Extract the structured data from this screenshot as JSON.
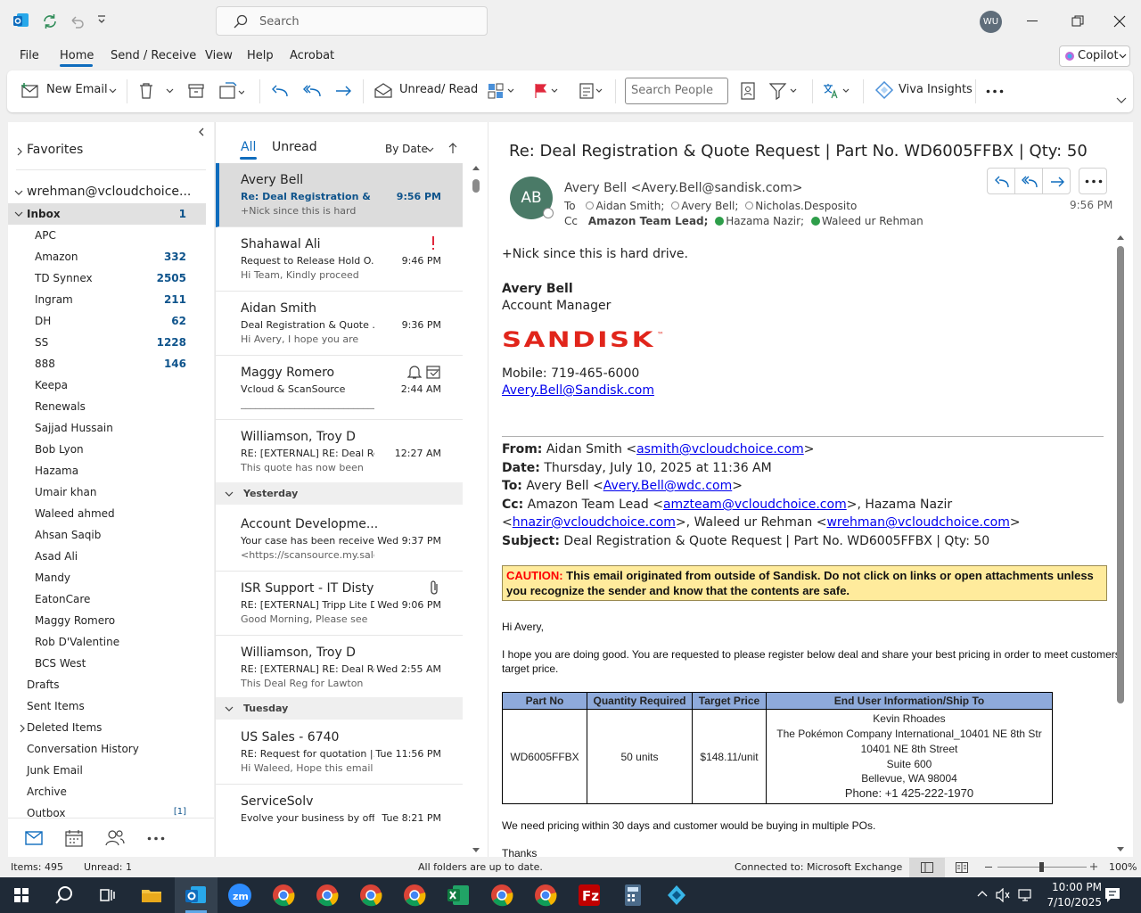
{
  "titlebar": {
    "search_placeholder": "Search",
    "user_initials": "WU"
  },
  "menu": {
    "items": [
      "File",
      "Home",
      "Send / Receive",
      "View",
      "Help",
      "Acrobat"
    ],
    "copilot": "Copilot"
  },
  "ribbon": {
    "new_email": "New Email",
    "unread_read": "Unread/ Read",
    "search_people_placeholder": "Search People",
    "viva": "Viva Insights"
  },
  "folders": {
    "favorites": "Favorites",
    "account": "wrehman@vcloudchoice...",
    "inbox": {
      "label": "Inbox",
      "count": "1"
    },
    "subfolders": [
      {
        "label": "APC",
        "count": ""
      },
      {
        "label": "Amazon",
        "count": "332"
      },
      {
        "label": "TD Synnex",
        "count": "2505"
      },
      {
        "label": "Ingram",
        "count": "211"
      },
      {
        "label": "DH",
        "count": "62"
      },
      {
        "label": "SS",
        "count": "1228"
      },
      {
        "label": "888",
        "count": "146"
      },
      {
        "label": "Keepa",
        "count": ""
      },
      {
        "label": "Renewals",
        "count": ""
      },
      {
        "label": "Sajjad Hussain",
        "count": ""
      },
      {
        "label": "Bob Lyon",
        "count": ""
      },
      {
        "label": "Hazama",
        "count": ""
      },
      {
        "label": "Umair khan",
        "count": ""
      },
      {
        "label": "Waleed ahmed",
        "count": ""
      },
      {
        "label": "Ahsan Saqib",
        "count": ""
      },
      {
        "label": "Asad Ali",
        "count": ""
      },
      {
        "label": "Mandy",
        "count": ""
      },
      {
        "label": "EatonCare",
        "count": ""
      },
      {
        "label": "Maggy Romero",
        "count": ""
      },
      {
        "label": "Rob D'Valentine",
        "count": ""
      },
      {
        "label": "BCS West",
        "count": ""
      }
    ],
    "top_level": [
      "Drafts",
      "Sent Items",
      "Deleted Items",
      "Conversation History",
      "Junk Email",
      "Archive"
    ],
    "outbox": {
      "label": "Outbox",
      "count": "[1]"
    }
  },
  "msglist": {
    "tab_all": "All",
    "tab_unread": "Unread",
    "sort": "By Date",
    "groups": {
      "yesterday": "Yesterday",
      "tuesday": "Tuesday"
    },
    "messages": [
      {
        "sender": "Avery Bell",
        "subject": "Re: Deal Registration & Qu...",
        "preview": "+Nick since this is hard",
        "time": "9:56 PM"
      },
      {
        "sender": "Shahawal Ali",
        "subject": "Request to Release Hold O...",
        "preview": "Hi Team,  Kindly proceed",
        "time": "9:46 PM"
      },
      {
        "sender": "Aidan Smith",
        "subject": "Deal Registration & Quote ...",
        "preview": "Hi Avery,  I hope you are",
        "time": "9:36 PM"
      },
      {
        "sender": "Maggy Romero",
        "subject": "Vcloud & ScanSource",
        "preview": "______________________________",
        "time": "2:44 AM"
      },
      {
        "sender": "Williamson, Troy D",
        "subject": "RE: [EXTERNAL] RE: Deal Re...",
        "preview": "This quote has now been",
        "time": "12:27 AM"
      },
      {
        "sender": "Account Developme...",
        "subject": "Your case has been received!",
        "preview": "<https://scansource.my.sales",
        "time": "Wed 9:37 PM"
      },
      {
        "sender": "ISR Support - IT Disty",
        "subject": "RE: [EXTERNAL] Tripp Lite D...",
        "preview": "Good Morning,  Please see",
        "time": "Wed 9:06 PM"
      },
      {
        "sender": "Williamson, Troy D",
        "subject": "RE: [EXTERNAL] RE: Deal Re...",
        "preview": "This Deal Reg for Lawton",
        "time": "Wed 2:55 AM"
      },
      {
        "sender": "US Sales - 6740",
        "subject": "RE: Request for quotation |...",
        "preview": "Hi Waleed,  Hope this email",
        "time": "Tue 11:56 PM"
      },
      {
        "sender": "ServiceSolv",
        "subject": "Evolve your business by off...",
        "preview": "",
        "time": "Tue 8:21 PM"
      }
    ]
  },
  "email": {
    "subject": "Re: Deal Registration & Quote Request | Part No. WD6005FFBX | Qty: 50",
    "avatar": "AB",
    "from": "Avery Bell <Avery.Bell@sandisk.com>",
    "to_label": "To",
    "to": [
      "Aidan Smith;",
      "Avery Bell;",
      "Nicholas.Desposito"
    ],
    "cc_label": "Cc",
    "cc": [
      "Amazon Team Lead;",
      "Hazama Nazir;",
      "Waleed ur Rehman"
    ],
    "time": "9:56 PM",
    "intro": "+Nick since this is hard drive.",
    "sig_name": "Avery Bell",
    "sig_title": "Account Manager",
    "logo": "SANDISK",
    "mobile": "Mobile: 719-465-6000",
    "sig_email": "Avery.Bell@Sandisk.com",
    "fwd": {
      "from_label": "From:",
      "from_name": "Aidan Smith <",
      "from_email": "asmith@vcloudchoice.com",
      "date_label": "Date:",
      "date": "Thursday, July 10, 2025 at 11:36 AM",
      "to_label": "To:",
      "to_name": "Avery Bell <",
      "to_email": "Avery.Bell@wdc.com",
      "cc_label": "Cc:",
      "cc_name1": "Amazon Team Lead <",
      "cc_email1": "amzteam@vcloudchoice.com",
      "cc_name2": ">, Hazama Nazir",
      "cc_email2": "hnazir@vcloudchoice.com",
      "cc_name3": ">, Waleed ur Rehman <",
      "cc_email3": "wrehman@vcloudchoice.com",
      "subject_label": "Subject:",
      "subject": "Deal Registration & Quote Request | Part No. WD6005FFBX | Qty: 50"
    },
    "caution_label": "CAUTION:",
    "caution_text": "This email originated from outside of Sandisk. Do not click on links or open attachments unless",
    "caution_text2": "you recognize the sender and know that the contents are safe.",
    "greeting": "Hi Avery,",
    "para1": "I hope you are doing good. You are requested to please register below deal and share your best pricing in order to meet customers",
    "para1b": "target price.",
    "table": {
      "headers": [
        "Part No",
        "Quantity Required",
        "Target Price",
        "End User Information/Ship To"
      ],
      "part": "WD6005FFBX",
      "qty": "50 units",
      "price": "$148.11/unit",
      "enduser": [
        "Kevin Rhoades",
        "The Pokémon Company International_10401 NE 8th Str",
        "10401 NE 8th Street",
        "Suite 600",
        "Bellevue, WA 98004",
        "Phone: +1 425-222-1970"
      ]
    },
    "para2": "We need pricing within 30 days and customer would be buying in multiple POs.",
    "thanks": "Thanks"
  },
  "statusbar": {
    "items": "Items: 495",
    "unread": "Unread: 1",
    "sync": "All folders are up to date.",
    "connected": "Connected to: Microsoft Exchange",
    "zoom": "100%"
  },
  "taskbar": {
    "time": "10:00 PM",
    "date": "7/10/2025"
  },
  "colors": {
    "accent": "#0f6cbd",
    "caution_bg": "#ffeb9c",
    "table_header": "#8eaadb",
    "taskbar": "#1f2a37"
  }
}
